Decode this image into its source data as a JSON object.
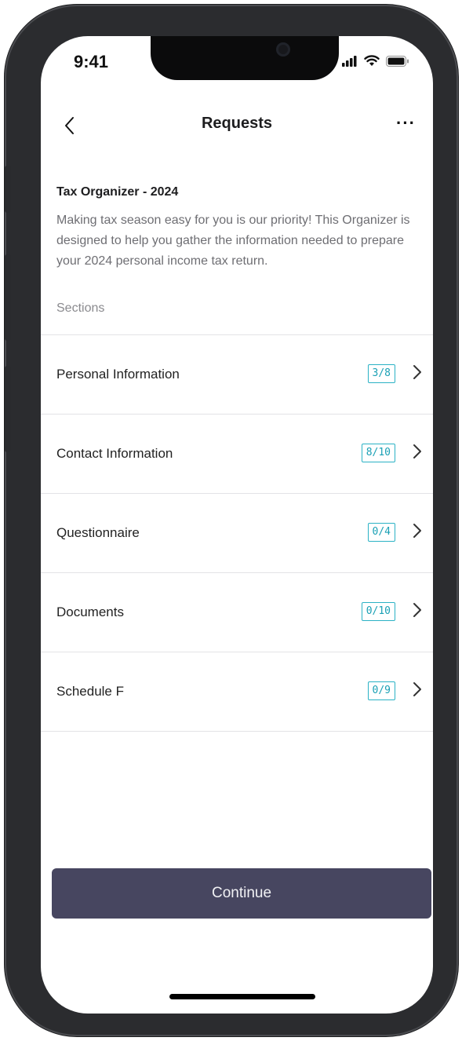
{
  "status_bar": {
    "time": "9:41",
    "icons": [
      "cellular-signal-icon",
      "wifi-icon",
      "battery-icon"
    ]
  },
  "nav": {
    "title": "Requests",
    "back_icon": "chevron-left-icon",
    "more_label": "···"
  },
  "organizer": {
    "title": "Tax Organizer - 2024",
    "description": "Making tax season easy for you is our priority! This Organizer is designed to help you gather the information needed to prepare your 2024 personal income tax return."
  },
  "sections": {
    "label": "Sections",
    "items": [
      {
        "label": "Personal Information",
        "progress": "3/8"
      },
      {
        "label": "Contact Information",
        "progress": "8/10"
      },
      {
        "label": "Questionnaire",
        "progress": "0/4"
      },
      {
        "label": "Documents",
        "progress": "0/10"
      },
      {
        "label": "Schedule F",
        "progress": "0/9"
      }
    ]
  },
  "footer": {
    "continue_label": "Continue"
  },
  "colors": {
    "accent": "#2bb2c5",
    "button_bg": "#474660"
  }
}
